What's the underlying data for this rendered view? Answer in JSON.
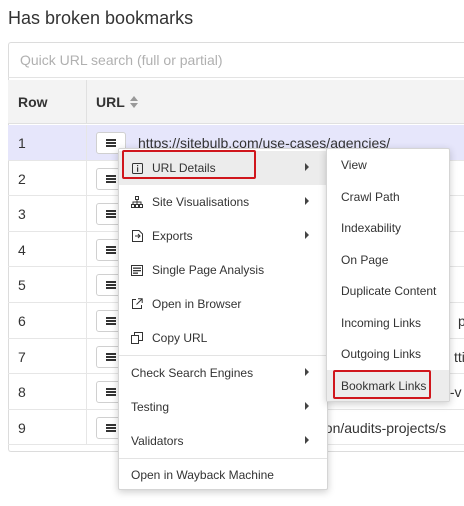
{
  "page": {
    "title": "Has broken bookmarks"
  },
  "search": {
    "placeholder": "Quick URL search (full or partial)"
  },
  "table": {
    "headers": {
      "row": "Row",
      "url": "URL"
    },
    "rows": [
      {
        "num": "1",
        "url": "https://sitebulb.com/use-cases/agencies/"
      },
      {
        "num": "2",
        "url": ""
      },
      {
        "num": "3",
        "url": ""
      },
      {
        "num": "4",
        "url": ""
      },
      {
        "num": "5",
        "url": ""
      },
      {
        "num": "6",
        "url": "pt"
      },
      {
        "num": "7",
        "url": "tti"
      },
      {
        "num": "8",
        "url": "t-v"
      },
      {
        "num": "9",
        "url": "ation/audits-projects/s"
      }
    ]
  },
  "context_menu": {
    "items": [
      {
        "label": "URL Details",
        "icon": "info-square-icon",
        "submenu": true
      },
      {
        "label": "Site Visualisations",
        "icon": "sitemap-icon",
        "submenu": true
      },
      {
        "label": "Exports",
        "icon": "file-export-icon",
        "submenu": true
      },
      {
        "label": "Single Page Analysis",
        "icon": "list-page-icon",
        "submenu": false
      },
      {
        "label": "Open in Browser",
        "icon": "external-link-icon",
        "submenu": false
      },
      {
        "label": "Copy URL",
        "icon": "copy-icon",
        "submenu": false
      },
      {
        "label": "Check Search Engines",
        "submenu": true
      },
      {
        "label": "Testing",
        "submenu": true
      },
      {
        "label": "Validators",
        "submenu": true
      },
      {
        "label": "Open in Wayback Machine",
        "submenu": false
      }
    ]
  },
  "submenu": {
    "items": [
      "View",
      "Crawl Path",
      "Indexability",
      "On Page",
      "Duplicate Content",
      "Incoming Links",
      "Outgoing Links",
      "Bookmark Links"
    ]
  },
  "colors": {
    "highlight": "#d0161c",
    "selected_row": "#e6e6fb"
  }
}
